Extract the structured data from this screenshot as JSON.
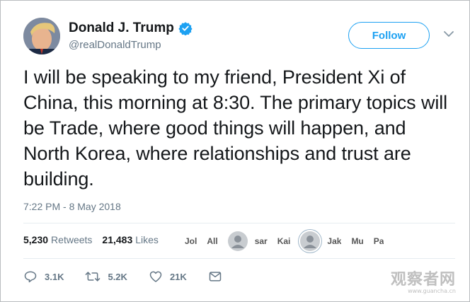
{
  "tweet": {
    "author": {
      "name": "Donald J. Trump",
      "handle": "@realDonaldTrump",
      "verified": true
    },
    "follow_label": "Follow",
    "text": "I will be speaking to my friend, President Xi of China, this morning at 8:30. The primary topics will be Trade, where good things will happen, and North Korea, where relationships and trust are building.",
    "timestamp": "7:22 PM - 8 May 2018",
    "stats": {
      "retweets_count": "5,230",
      "retweets_label": "Retweets",
      "likes_count": "21,483",
      "likes_label": "Likes"
    },
    "likers": [
      "Jol",
      "All",
      "sar",
      "Kai",
      "Jak",
      "Mu",
      "Pa"
    ],
    "actions": {
      "reply_count": "3.1K",
      "retweet_count": "5.2K",
      "like_count": "21K"
    }
  },
  "watermark": {
    "main": "观察者网",
    "sub": "www.guancha.cn"
  },
  "colors": {
    "accent": "#1da1f2",
    "text": "#14171a",
    "secondary": "#657786"
  },
  "icons": [
    "verified-badge-icon",
    "chevron-down-icon",
    "reply-icon",
    "retweet-icon",
    "like-icon",
    "direct-message-icon"
  ]
}
